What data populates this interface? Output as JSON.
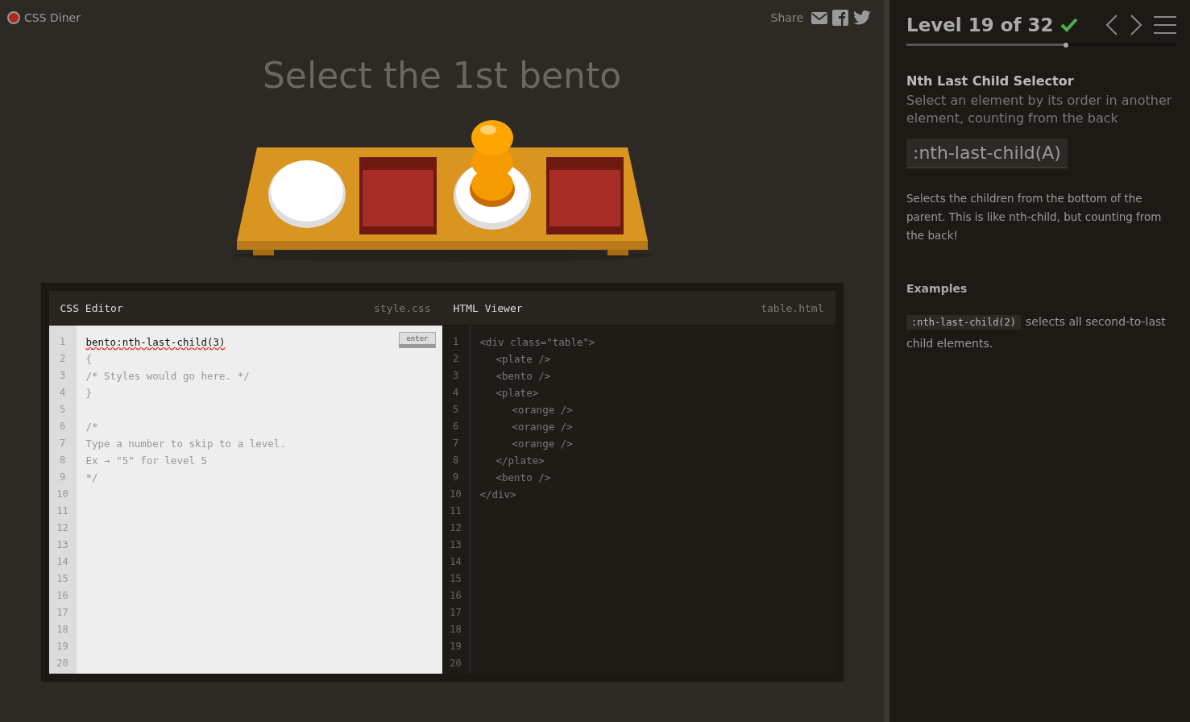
{
  "header": {
    "logo": "CSS Diner",
    "share": "Share"
  },
  "instruction": "Select the 1st bento",
  "css_editor": {
    "title": "CSS Editor",
    "file": "style.css",
    "enter": "enter",
    "line_numbers": [
      "1",
      "2",
      "3",
      "4",
      "5",
      "6",
      "7",
      "8",
      "9",
      "10",
      "11",
      "12",
      "13",
      "14",
      "15",
      "16",
      "17",
      "18",
      "19",
      "20"
    ],
    "lines": [
      {
        "text": "bento:nth-last-child(3)",
        "kind": "input",
        "misspelled": true
      },
      {
        "text": "{",
        "kind": "comment"
      },
      {
        "text": "/* Styles would go here. */",
        "kind": "comment"
      },
      {
        "text": "}",
        "kind": "comment"
      },
      {
        "kind": "blank"
      },
      {
        "text": "/*",
        "kind": "comment"
      },
      {
        "text": "Type a number to skip to a level.",
        "kind": "comment"
      },
      {
        "text": "Ex → \"5\" for level 5",
        "kind": "comment"
      },
      {
        "text": "*/",
        "kind": "comment"
      }
    ]
  },
  "html_viewer": {
    "title": "HTML Viewer",
    "file": "table.html",
    "line_numbers": [
      "1",
      "2",
      "3",
      "4",
      "5",
      "6",
      "7",
      "8",
      "9",
      "10",
      "11",
      "12",
      "13",
      "14",
      "15",
      "16",
      "17",
      "18",
      "19",
      "20"
    ],
    "lines": [
      {
        "text": "<div class=\"table\">",
        "children": [
          {
            "text": "<plate />"
          },
          {
            "text": "<bento />"
          },
          {
            "text": "<plate>",
            "children": [
              {
                "text": "<orange />"
              },
              {
                "text": "<orange />"
              },
              {
                "text": "<orange />"
              }
            ]
          },
          {
            "text": "</plate>"
          },
          {
            "text": "<bento />"
          }
        ]
      },
      {
        "text": "</div>"
      }
    ]
  },
  "sidebar": {
    "level": "Level 19 of 32",
    "completed": true,
    "progress": {
      "level": 0.59
    },
    "title": "Nth Last Child Selector",
    "subtitle": "Select an element by its order in another element, counting from the back",
    "syntax": ":nth-last-child(A)",
    "description": "Selects the children from the bottom of the parent. This is like nth-child, but counting from the back!",
    "examples_title": "Examples",
    "examples": [
      {
        "code": ":nth-last-child(2)",
        "text": "selects all second-to-last child elements."
      }
    ]
  }
}
